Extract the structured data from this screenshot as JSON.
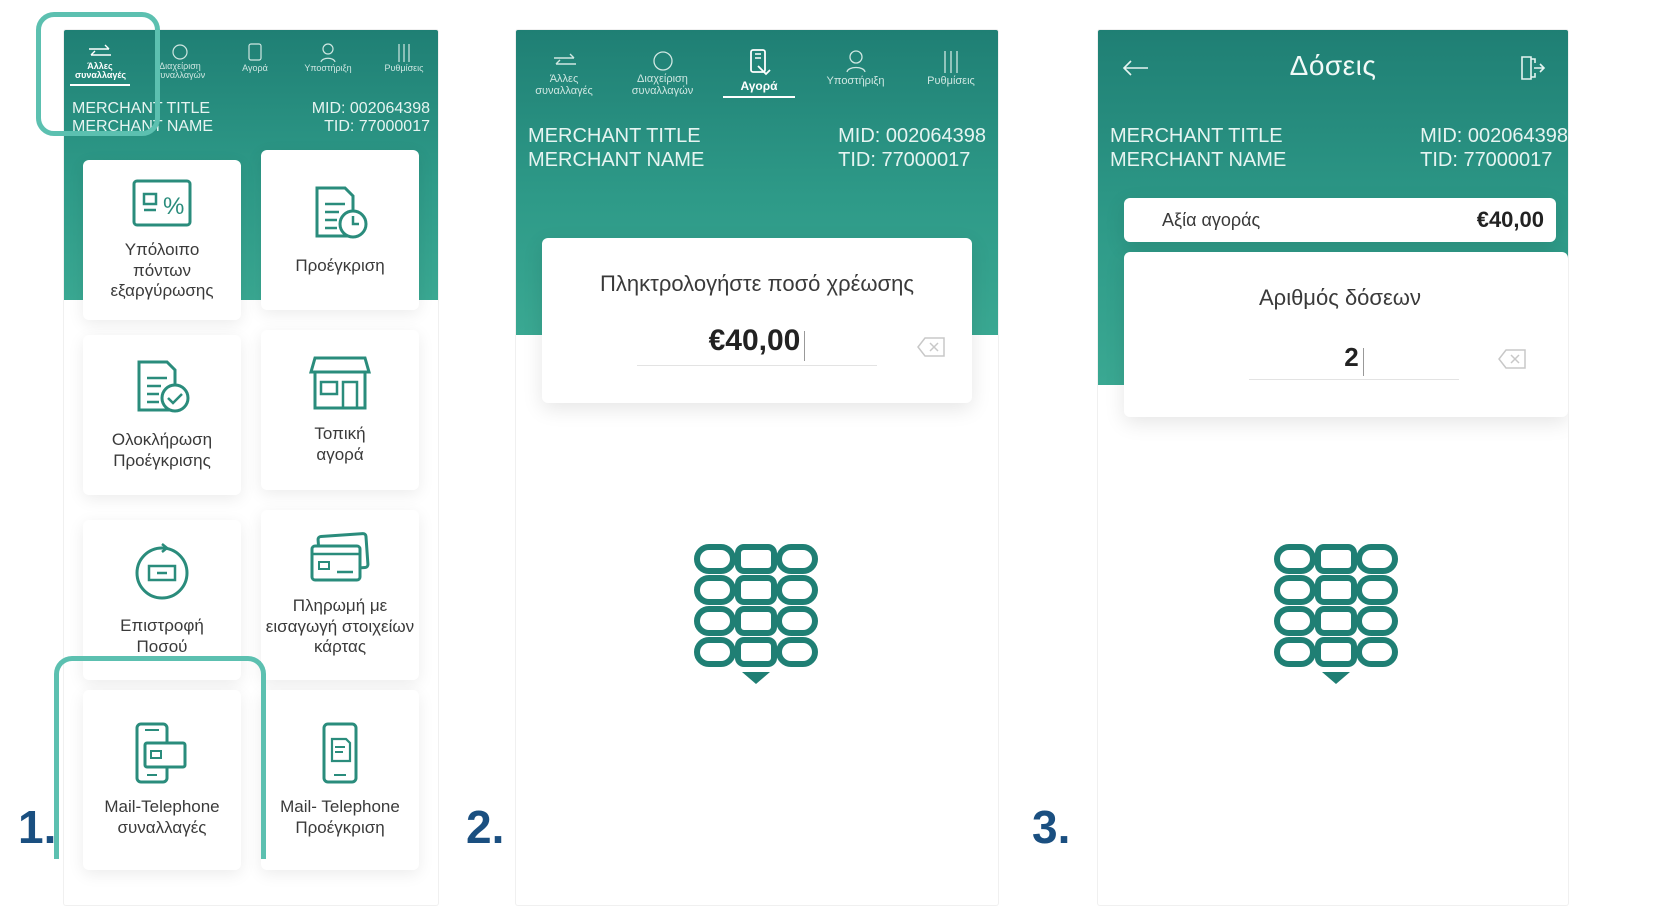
{
  "steps": {
    "one": "1.",
    "two": "2.",
    "three": "3."
  },
  "nav": {
    "other": "Άλλες συναλλαγές",
    "manage": "Διαχείριση συναλλαγών",
    "purchase": "Αγορά",
    "support": "Υποστήριξη",
    "settings": "Ρυθμίσεις"
  },
  "merchant": {
    "title": "MERCHANT TITLE",
    "name": "MERCHANT NAME",
    "mid": "MID: 002064398",
    "tid": "TID: 77000017"
  },
  "tiles": {
    "points": "Υπόλοιπο πόντων εξαργύρωσης",
    "preauth": "Προέγκριση",
    "complete": "Ολοκλήρωση Προέγκρισης",
    "local": "Τοπική αγορά",
    "refund": "Επιστροφή Ποσού",
    "manual": "Πληρωμή με εισαγωγή στοιχείων κάρτας",
    "moto": "Mail-Telephone συναλλαγές",
    "moto_pre": "Mail- Telephone Προέγκριση"
  },
  "amount_screen": {
    "prompt": "Πληκτρολογήστε ποσό χρέωσης",
    "amount": "€40,00"
  },
  "installments_screen": {
    "title": "Δόσεις",
    "value_label": "Αξία αγοράς",
    "value": "€40,00",
    "count_label": "Αριθμός δόσεων",
    "count": "2"
  },
  "colors": {
    "teal": "#2e9a88",
    "accent": "#1f7f74",
    "step": "#1a4f80",
    "highlight": "#5cc0b0"
  }
}
